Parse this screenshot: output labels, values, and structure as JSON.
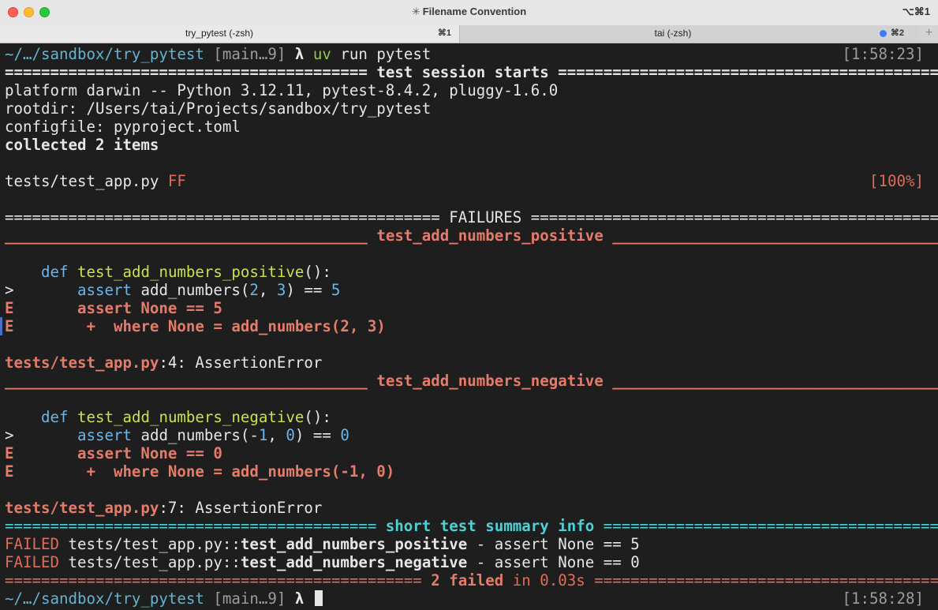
{
  "window": {
    "title": "Filename Convention",
    "title_glyph": "✳",
    "shortcut": "⌥⌘1"
  },
  "tabs": [
    {
      "label": "try_pytest (-zsh)",
      "shortcut": "⌘1"
    },
    {
      "label": "tai (-zsh)",
      "shortcut": "⌘2"
    }
  ],
  "new_tab": "+",
  "prompt1": {
    "path": "~/…/sandbox/try_pytest",
    "branch": " [main…9] ",
    "lambda": "λ",
    "cmd_uv": "uv",
    "cmd_rest": " run pytest",
    "time": "[1:58:23]"
  },
  "header": {
    "bar_left": "========================================",
    "title": " test session starts ",
    "bar_right": "=========================================="
  },
  "info": {
    "platform": "platform darwin -- Python 3.12.11, pytest-8.4.2, pluggy-1.6.0",
    "rootdir": "rootdir: /Users/tai/Projects/sandbox/try_pytest",
    "configfile": "configfile: pyproject.toml",
    "collected": "collected 2 items"
  },
  "progress": {
    "file": "tests/test_app.py ",
    "result": "FF",
    "percent": "[100%]"
  },
  "failures": {
    "bar_left": "================================================",
    "title": " FAILURES ",
    "bar_right": "================================================"
  },
  "failure1": {
    "bar_left": "________________________________________",
    "name": " test_add_numbers_positive ",
    "bar_right": "____________________________________________",
    "def_kw": "def",
    "def_fn": "test_add_numbers_positive",
    "def_rest": "():",
    "marker": ">",
    "assert_kw": "assert",
    "call": " add_numbers(",
    "arg1": "2",
    "sep": ", ",
    "arg2": "3",
    "close": ") == ",
    "expected": "5",
    "e1": "E       assert None == 5",
    "e2": "E        +  where None = add_numbers(2, 3)",
    "loc_file": "tests/test_app.py",
    "loc_rest": ":4: AssertionError"
  },
  "failure2": {
    "bar_left": "________________________________________",
    "name": " test_add_numbers_negative ",
    "bar_right": "____________________________________________",
    "def_kw": "def",
    "def_fn": "test_add_numbers_negative",
    "def_rest": "():",
    "marker": ">",
    "assert_kw": "assert",
    "call": " add_numbers(",
    "arg1_sign": "-",
    "arg1": "1",
    "sep": ", ",
    "arg2": "0",
    "close": ") == ",
    "expected": "0",
    "e1": "E       assert None == 0",
    "e2": "E        +  where None = add_numbers(-1, 0)",
    "loc_file": "tests/test_app.py",
    "loc_rest": ":7: AssertionError"
  },
  "summary": {
    "bar_left": "=========================================",
    "title": " short test summary info ",
    "bar_right": "=========================================="
  },
  "summary_lines": [
    {
      "status": "FAILED",
      "path": " tests/test_app.py::",
      "test": "test_add_numbers_positive",
      "msg": " - assert None == 5"
    },
    {
      "status": "FAILED",
      "path": " tests/test_app.py::",
      "test": "test_add_numbers_negative",
      "msg": " - assert None == 0"
    }
  ],
  "final": {
    "bar_left": "============================================== ",
    "count": "2 failed",
    "time": " in 0.03s ",
    "bar_right": "============================================"
  },
  "prompt2": {
    "path": "~/…/sandbox/try_pytest",
    "branch": " [main…9] ",
    "lambda": "λ",
    "time": "[1:58:28]"
  },
  "colors": {
    "background": "#1e1e1e",
    "fail_red": "#e06c5a",
    "path_blue": "#63b4d1",
    "summary_cyan": "#4fd0d4",
    "function_yellow": "#c6e34d"
  }
}
